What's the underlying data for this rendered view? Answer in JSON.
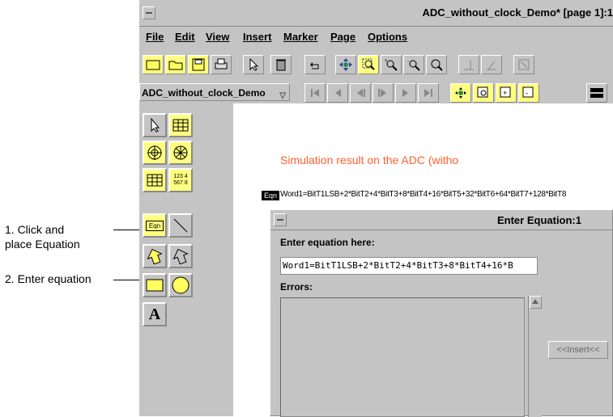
{
  "callouts": {
    "step1_line1": "1. Click and",
    "step1_line2": "place Equation",
    "step2": "2. Enter equation"
  },
  "window": {
    "title": "ADC_without_clock_Demo* [page 1]:1"
  },
  "menu": {
    "items": [
      "File",
      "Edit",
      "View",
      "Insert",
      "Marker",
      "Page",
      "Options"
    ]
  },
  "toolbar2": {
    "doc_select": "ADC_without_clock_Demo"
  },
  "palette": {
    "eqn_label": "Eqn",
    "grid_label_top": "123 4",
    "grid_label_bottom": "567 8",
    "text_tool_label": "A"
  },
  "canvas": {
    "sim_title": "Simulation result on the ADC (witho",
    "eqn_tag": "Eqn",
    "equation_text": "Word1=BitT1LSB+2*BitT2+4*BitT3+8*BitT4+16*BitT5+32*BitT6+64*BitT7+128*BitT8"
  },
  "dialog": {
    "title": "Enter Equation:1",
    "enter_label": "Enter equation here:",
    "input_value": "Word1=BitT1LSB+2*BitT2+4*BitT3+8*BitT4+16*B",
    "errors_label": "Errors:",
    "insert_button": "<<Insert<<"
  },
  "colors": {
    "window_bg": "#c4c4c4",
    "sim_title": "#ff6030",
    "tool_highlight": "#ffff80"
  }
}
